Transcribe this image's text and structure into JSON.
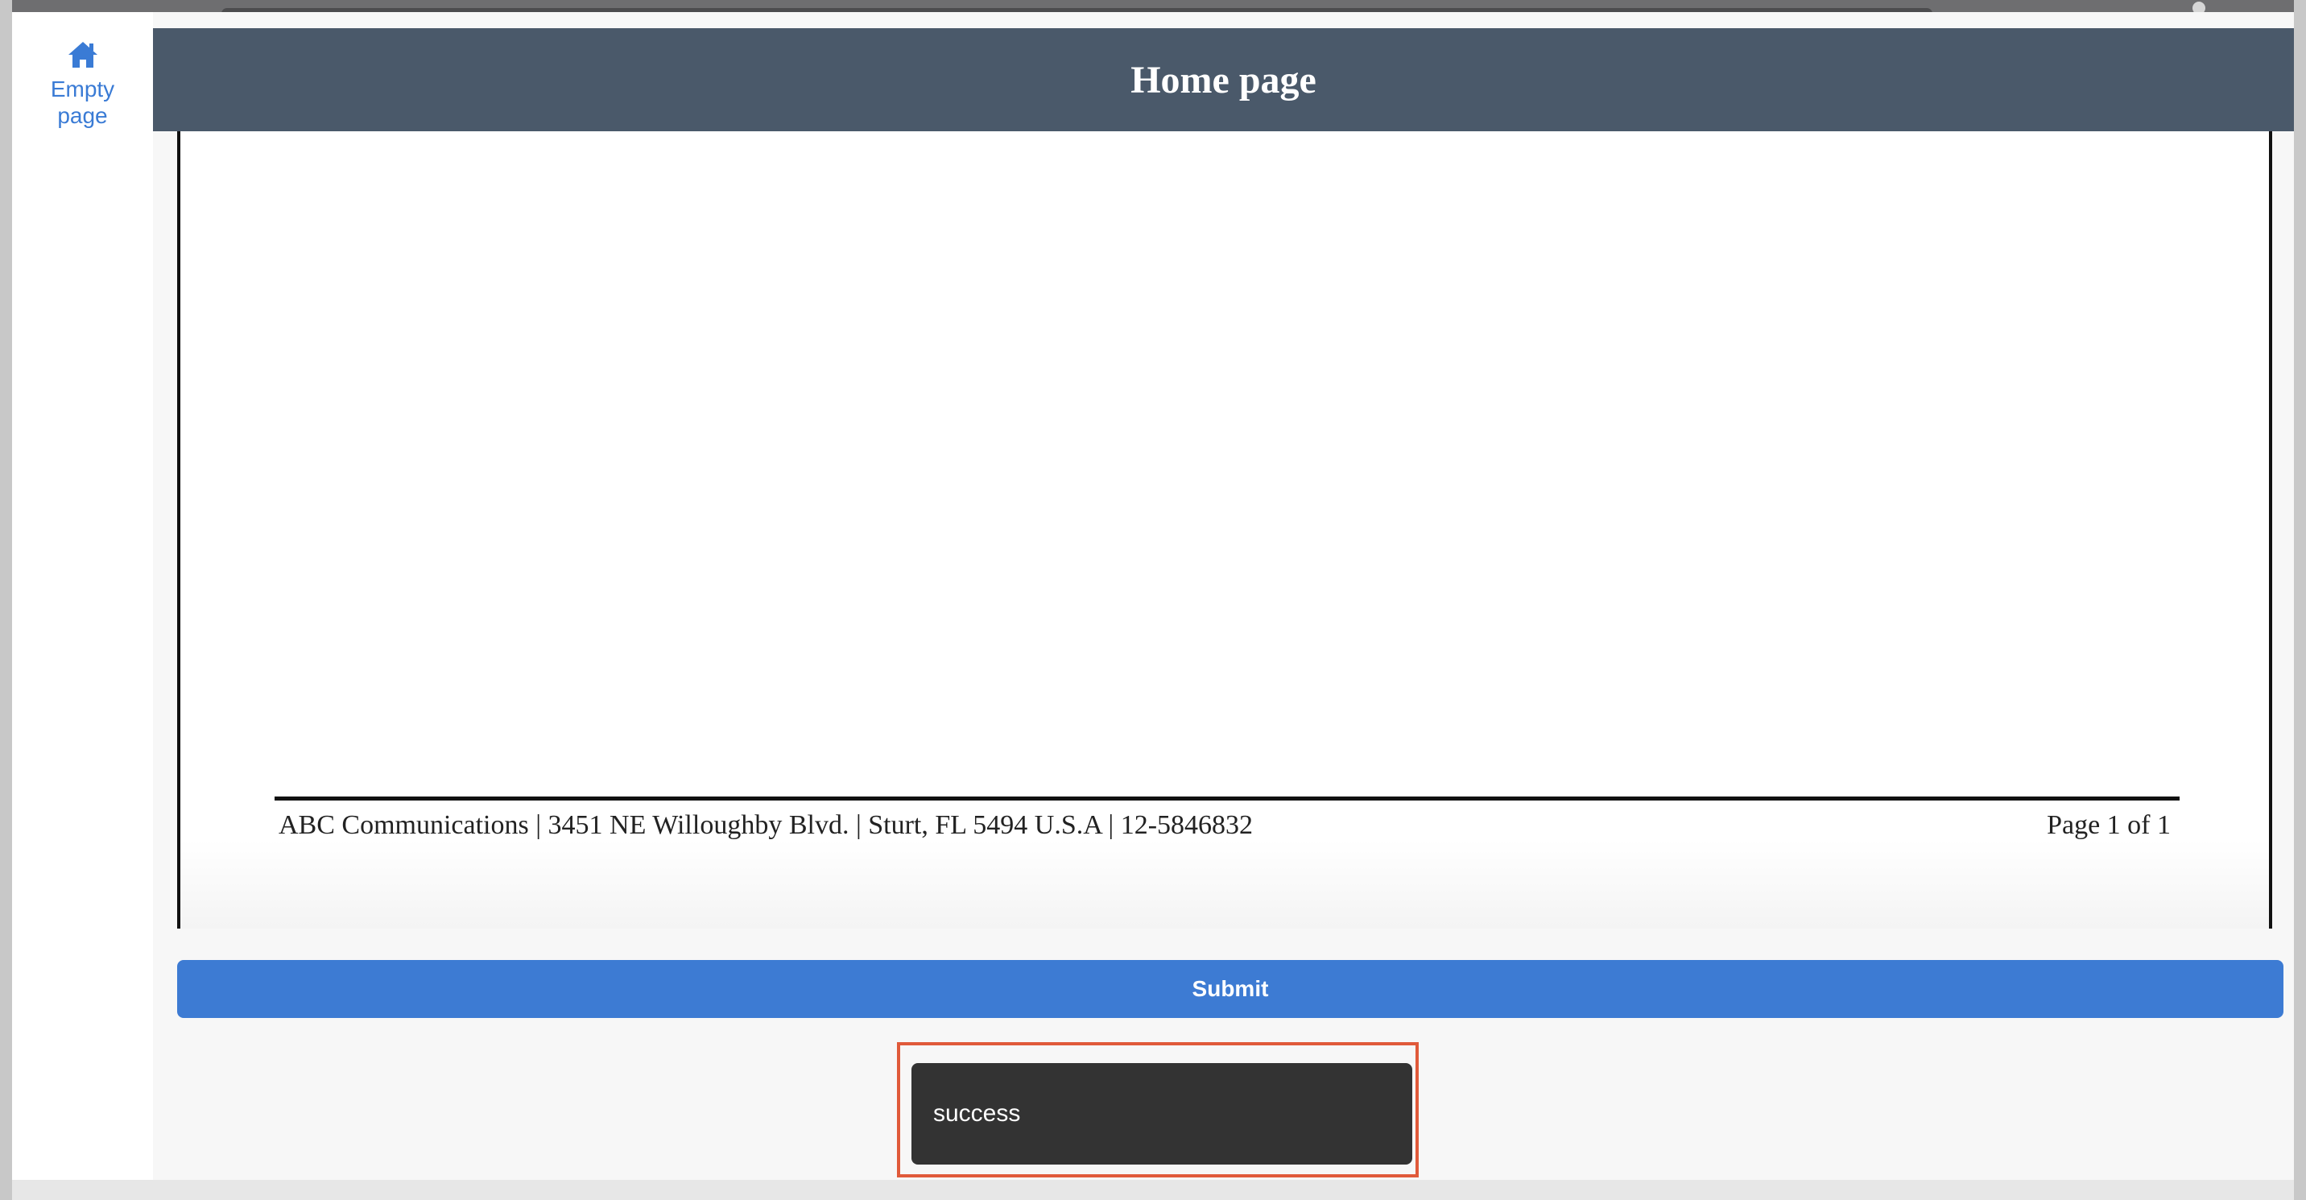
{
  "sidebar": {
    "items": [
      {
        "icon": "home-icon",
        "label": "Empty page"
      }
    ]
  },
  "header": {
    "title": "Home page"
  },
  "document": {
    "footer_left": "ABC Communications | 3451 NE Willoughby Blvd. | Sturt, FL 5494 U.S.A | 12-5846832",
    "footer_right": "Page 1 of 1"
  },
  "actions": {
    "submit_label": "Submit"
  },
  "toast": {
    "message": "success"
  },
  "colors": {
    "header_bg": "#4a596a",
    "accent": "#3d7bd3",
    "toast_bg": "#333333",
    "highlight": "#e05a3a"
  }
}
